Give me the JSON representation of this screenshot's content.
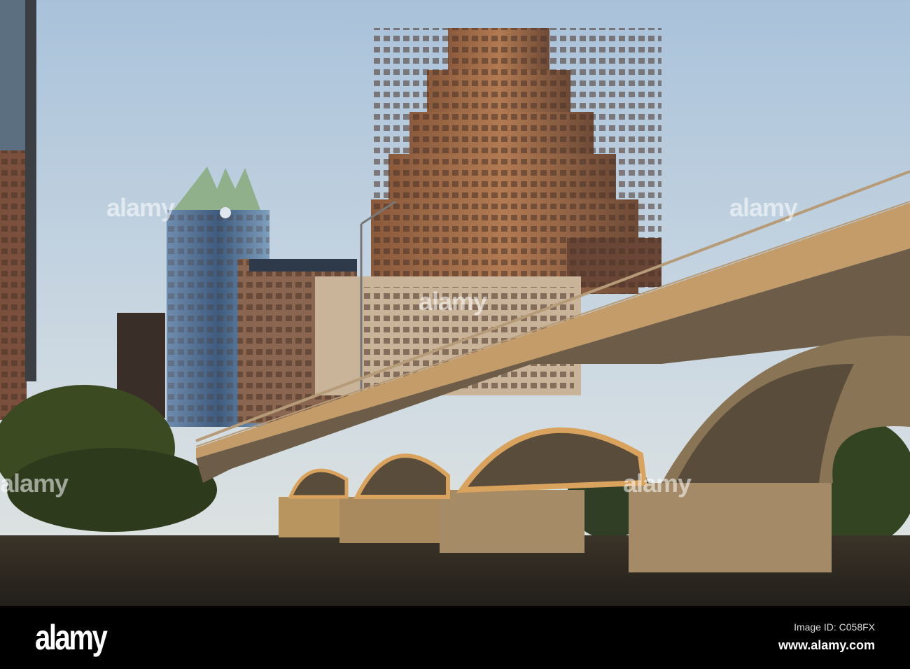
{
  "footer": {
    "logo": "alamy",
    "image_id": "Image ID: C058FX",
    "url": "www.alamy.com"
  },
  "watermark": {
    "text": "alamy",
    "mark": "a"
  },
  "colors": {
    "sky_top": "#a9c2da",
    "sky_bottom": "#dfe4e3",
    "water": "#2b2620",
    "footer": "#000000"
  }
}
